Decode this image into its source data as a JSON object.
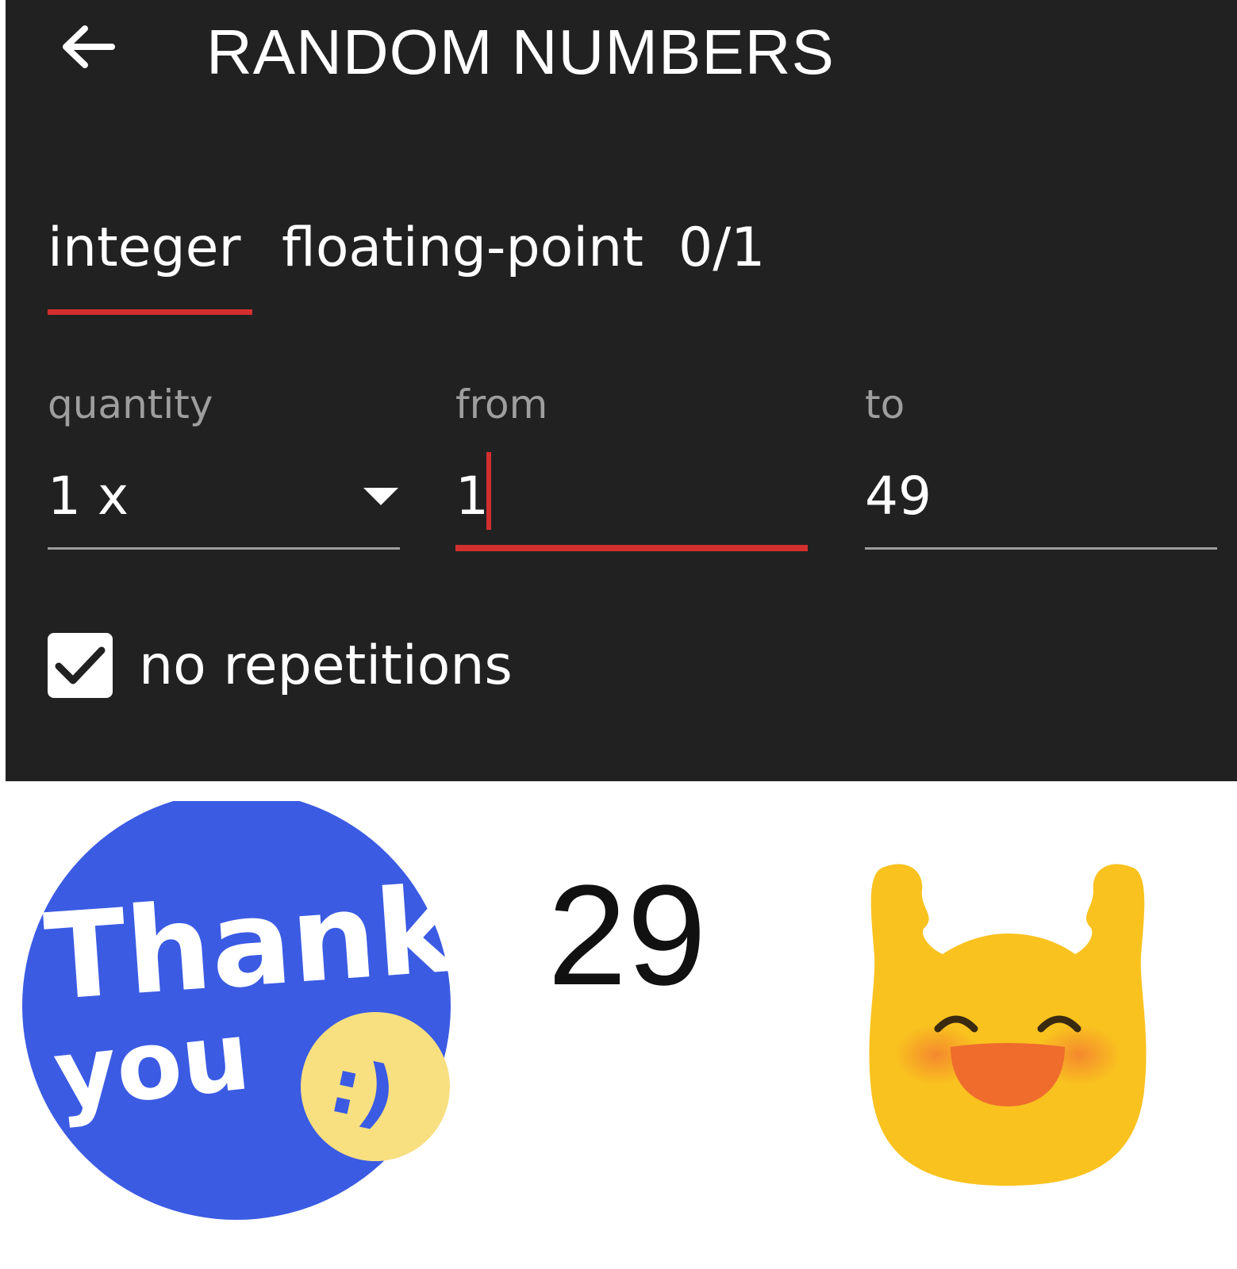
{
  "header": {
    "title": "RANDOM NUMBERS",
    "back_icon": "arrow-left-icon"
  },
  "tabs": [
    {
      "label": "integer",
      "selected": true
    },
    {
      "label": "floating-point",
      "selected": false
    },
    {
      "label": "0/1",
      "selected": false
    }
  ],
  "fields": {
    "quantity": {
      "label": "quantity",
      "value": "1 x"
    },
    "from": {
      "label": "from",
      "value": "1"
    },
    "to": {
      "label": "to",
      "value": "49"
    }
  },
  "options": {
    "no_repetitions": {
      "label": "no repetitions",
      "checked": true
    }
  },
  "result": {
    "value": "29"
  },
  "stickers": {
    "left": {
      "text_line1": "Thank",
      "text_line2": "you",
      "smiley": ":)"
    },
    "right": {
      "name": "raising-hands-emoji"
    }
  },
  "colors": {
    "panel_bg": "#212121",
    "accent": "#d32f2f",
    "label_gray": "#9e9e9e",
    "sticker_blue": "#3b5be3",
    "sticker_yellow": "#f8df80",
    "emoji_yellow": "#f9c21f",
    "emoji_mouth": "#ef6c2d"
  }
}
